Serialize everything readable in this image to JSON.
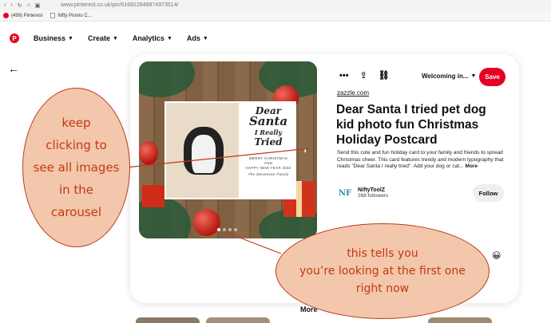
{
  "browser": {
    "url": "www.pinterest.co.uk/pin/616922848974973514/",
    "bookmarks": [
      {
        "label": "(499) Pinterest"
      },
      {
        "label": "Nifty Promo C..."
      }
    ]
  },
  "nav": {
    "items": [
      "Business",
      "Create",
      "Analytics",
      "Ads"
    ]
  },
  "pin": {
    "board_selector": "Welcoming in...",
    "save_label": "Save",
    "source": "zazzle.com",
    "title": "Dear Santa I tried pet dog kid photo fun Christmas Holiday Postcard",
    "description": "Send this cute and fun holiday card to your family and friends to spread Christmas cheer. This card features trendy and modern typography that reads \"Dear Santa I really tried\". Add your dog or cat...",
    "more_label": "More",
    "image": {
      "script_text": [
        "Dear",
        "Santa",
        "I Really",
        "Tried"
      ],
      "greeting_1": "MERRY CHRISTMAS",
      "greeting_2": "AND",
      "greeting_3": "HAPPY NEW YEAR 2032",
      "family": "The Stevenson Family"
    },
    "carousel": {
      "total": 4,
      "active_index": 0
    }
  },
  "creator": {
    "name": "NiftyToolZ",
    "followers": "268 followers",
    "follow_label": "Follow",
    "logo_text": "NF"
  },
  "footer": {
    "more_like_this": "More"
  },
  "annotations": {
    "left": [
      "keep",
      "clicking to",
      "see all images",
      "in the",
      "carousel"
    ],
    "right": [
      "this tells you",
      "you’re looking at the first one",
      "right now"
    ]
  },
  "colors": {
    "brand_red": "#e60023",
    "annotation_fill": "#f2c7ab",
    "annotation_text": "#c43a12"
  }
}
